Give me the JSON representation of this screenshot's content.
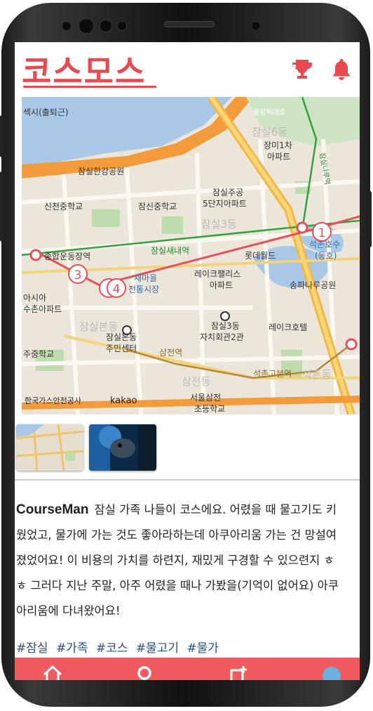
{
  "app": {
    "title": "코스모스",
    "brand_color": "#e84a4f",
    "icons": [
      "trophy-icon",
      "bell-icon"
    ]
  },
  "map": {
    "labels": {
      "jamsil6": "잠실6동",
      "jangmi": "장미1차",
      "apt": "아파트",
      "jamsilnaru": "잠실나루역",
      "hangang": "잠실한강공원",
      "sincheon_school": "신천중학교",
      "jamsin_school": "잠신중학교",
      "jugong1": "잠실주공",
      "jugong2": "5단지아파트",
      "jamsil3_faint": "잠실3동",
      "station_sports": "종합운동장역",
      "station_saenae": "잠실새내역",
      "lotte_world": "롯데월드",
      "seokchon_lake1": "석촌호수",
      "seokchon_lake2": "(동호)",
      "saemaeul1": "새마을",
      "saemaeul2": "전통시장",
      "lakepalace1": "레이크팰리스",
      "lakepalace2": "아파트",
      "songpa_park": "송파나루공원",
      "asia1": "아시아",
      "asia2": "수촌아파트",
      "jamsilbon_faint": "잠실본동",
      "center1": "잠실본동",
      "center2": "주민센터",
      "hall1": "잠실3동",
      "hall2": "자치회관2관",
      "lake_hotel": "레이크호텔",
      "sincheon_school2": "주중학교",
      "sangjeon": "삼전역",
      "seokchongobun": "석촌고분역",
      "samjeon_faint": "삼전동",
      "seokchon_faint": "석촌동",
      "samjeon_school1": "서울삼전",
      "samjeon_school2": "초등학교",
      "kakao": "kakao",
      "kakao_garbled": "한국가스안전공사",
      "top_left": "섹시(출퇴근)",
      "top_road": "올림픽대로"
    },
    "markers": [
      "1",
      "3",
      "4"
    ],
    "route_color": "#e6505a"
  },
  "post": {
    "author": "CourseMan",
    "lines": [
      "잠실 가족 나들이 코스에요. 어렸을 때 물고기도 키",
      "웠었고, 물가에 가는 것도 좋아라하는데 아쿠아리움 가는 건 망설여",
      "졌었어요! 이 비용의 가치를 하련지, 재밌게 구경할 수 있으련지 ㅎ",
      "ㅎ 그러다 지난 주말, 아주 어렸을 때나 가봤을(기억이 없어요) 아쿠",
      "아리움에 다녀왔어요!"
    ],
    "tags": [
      "#잠실",
      "#가족",
      "#코스",
      "#물고기",
      "#물가"
    ]
  },
  "bottom_nav": {
    "color": "#ef5b5f",
    "items": [
      "home-icon",
      "search-icon",
      "add-course-icon",
      "profile-icon"
    ]
  }
}
